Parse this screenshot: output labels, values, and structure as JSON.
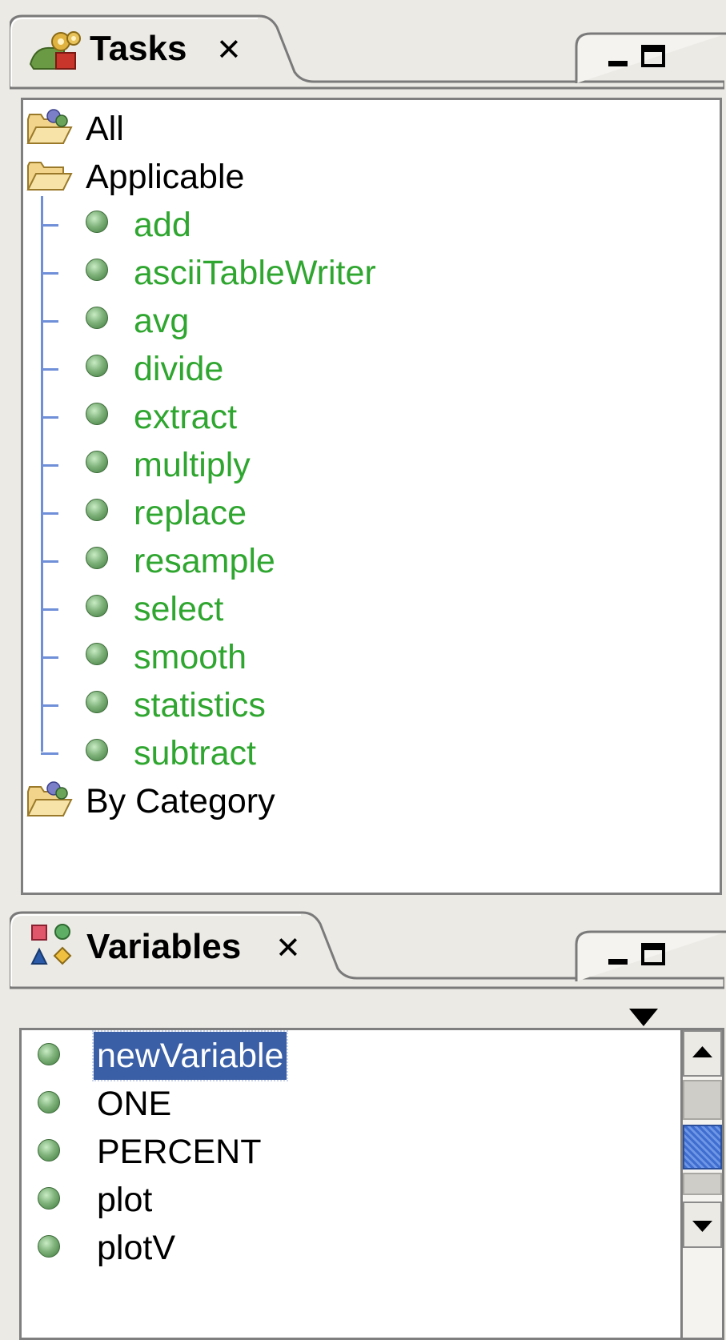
{
  "tasks_view": {
    "title": "Tasks",
    "close_glyph": "✕",
    "tab_icon": "tasks-gears-icon",
    "folders": {
      "all": "All",
      "applicable": "Applicable",
      "by_category": "By Category"
    },
    "applicable_tasks": [
      "add",
      "asciiTableWriter",
      "avg",
      "divide",
      "extract",
      "multiply",
      "replace",
      "resample",
      "select",
      "smooth",
      "statistics",
      "subtract"
    ]
  },
  "variables_view": {
    "title": "Variables",
    "close_glyph": "✕",
    "tab_icon": "variables-shapes-icon",
    "items": [
      "newVariable",
      "ONE",
      "PERCENT",
      "plot",
      "plotV"
    ],
    "selected_item": "newVariable"
  },
  "colors": {
    "task_text": "#2fa62f",
    "selection_bg": "#3a5fa6",
    "panel_bg": "#eceae5",
    "tree_line": "#6f8fd8"
  }
}
